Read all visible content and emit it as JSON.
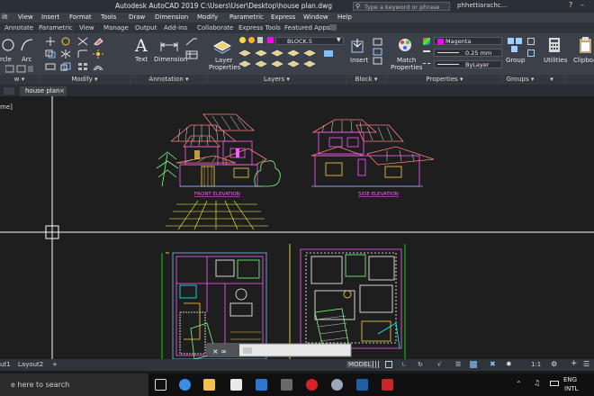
{
  "window": {
    "title": "Autodesk AutoCAD 2019    C:\\Users\\User\\Desktop\\house plan.dwg",
    "search_placeholder": "Type a keyword or phrase",
    "user": "phhettiarachc..."
  },
  "menu": [
    "ilt",
    "View",
    "Insert",
    "Format",
    "Tools",
    "Draw",
    "Dimension",
    "Modify",
    "Parametric",
    "Express",
    "Window",
    "Help"
  ],
  "ribbon_tabs": [
    "Annotate",
    "Parametric",
    "View",
    "Manage",
    "Output",
    "Add-ins",
    "Collaborate",
    "Express Tools",
    "Featured Apps"
  ],
  "ribbon": {
    "circle": "rcle",
    "arc": "Arc",
    "text": "Text",
    "dimension": "Dimension",
    "layer_properties_1": "Layer",
    "layer_properties_2": "Properties",
    "layer_dropdown": "BLOCK.5",
    "insert": "Insert",
    "match_1": "Match",
    "match_2": "Properties",
    "color": "Magenta",
    "lineweight": "0.25 mm",
    "linetype": "ByLayer",
    "group": "Group",
    "utilities": "Utilities",
    "clipboard": "Clipboa"
  },
  "panels": {
    "draw": "w",
    "modify": "Modify",
    "annotation": "Annotation",
    "layers": "Layers",
    "block": "Block",
    "properties": "Properties",
    "groups": "Groups"
  },
  "file_tab": "house plan",
  "canvas": {
    "viewport_label": "me]",
    "front_label": "FRONT ELEVATION",
    "side_label": "SIDE ELEVATION"
  },
  "layout_tabs": [
    "ut1",
    "Layout2",
    "+"
  ],
  "status": {
    "model": "MODEL",
    "scale": "1:1"
  },
  "taskbar": {
    "search": "e here to search",
    "lang_1": "ENG",
    "lang_2": "INTL"
  },
  "colors": {
    "accent_magenta": "#ff00ff",
    "title_bg": "#2b2f36",
    "ribbon_bg": "#3c4149",
    "canvas_bg": "#1e1e1e"
  }
}
